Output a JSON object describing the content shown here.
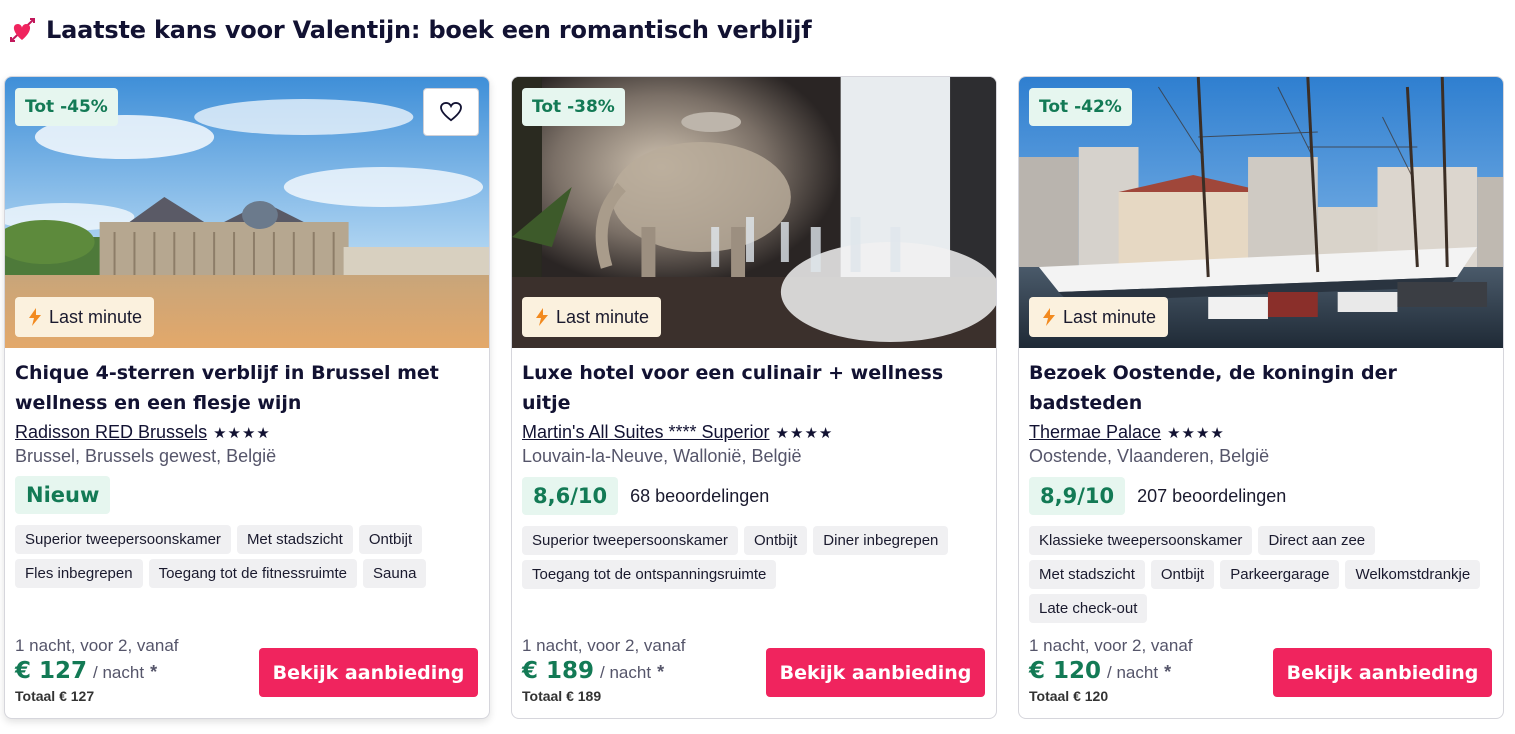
{
  "section": {
    "title": "Laatste kans voor Valentijn: boek een romantisch verblijf",
    "icon": "heart-arrow-icon"
  },
  "colors": {
    "brand_pink": "#f0245e",
    "badge_green_bg": "#e6f6ef",
    "badge_green_text": "#137a55",
    "last_minute_bg": "#fbf1de",
    "lightning": "#f28a1f"
  },
  "cards": [
    {
      "discount": "Tot -45%",
      "last_minute": "Last minute",
      "title": "Chique 4-sterren verblijf in Brussel met wellness en een flesje wijn",
      "hotel": "Radisson RED Brussels",
      "stars": "★★★★",
      "location": "Brussel, Brussels gewest, België",
      "badge": "Nieuw",
      "tags": [
        "Superior tweepersoonskamer",
        "Met stadszicht",
        "Ontbijt",
        "Fles inbegrepen",
        "Toegang tot de fitnessruimte",
        "Sauna"
      ],
      "price_label": "1 nacht, voor 2, vanaf",
      "price": "€ 127",
      "unit": "/ nacht",
      "asterisk": "*",
      "total": "Totaal € 127",
      "cta": "Bekijk aanbieding"
    },
    {
      "discount": "Tot -38%",
      "last_minute": "Last minute",
      "title": "Luxe hotel voor een culinair + wellness uitje",
      "hotel": "Martin's All Suites **** Superior",
      "stars": "★★★★",
      "location": "Louvain-la-Neuve, Wallonië, België",
      "score": "8,6/10",
      "reviews": "68 beoordelingen",
      "tags": [
        "Superior tweepersoonskamer",
        "Ontbijt",
        "Diner inbegrepen",
        "Toegang tot de ontspanningsruimte"
      ],
      "price_label": "1 nacht, voor 2, vanaf",
      "price": "€ 189",
      "unit": "/ nacht",
      "asterisk": "*",
      "total": "Totaal € 189",
      "cta": "Bekijk aanbieding"
    },
    {
      "discount": "Tot -42%",
      "last_minute": "Last minute",
      "title": "Bezoek Oostende, de koningin der badsteden",
      "hotel": "Thermae Palace",
      "stars": "★★★★",
      "location": "Oostende, Vlaanderen, België",
      "score": "8,9/10",
      "reviews": "207 beoordelingen",
      "tags": [
        "Klassieke tweepersoonskamer",
        "Direct aan zee",
        "Met stadszicht",
        "Ontbijt",
        "Parkeergarage",
        "Welkomstdrankje",
        "Late check-out"
      ],
      "price_label": "1 nacht, voor 2, vanaf",
      "price": "€ 120",
      "unit": "/ nacht",
      "asterisk": "*",
      "total": "Totaal € 120",
      "cta": "Bekijk aanbieding"
    }
  ]
}
